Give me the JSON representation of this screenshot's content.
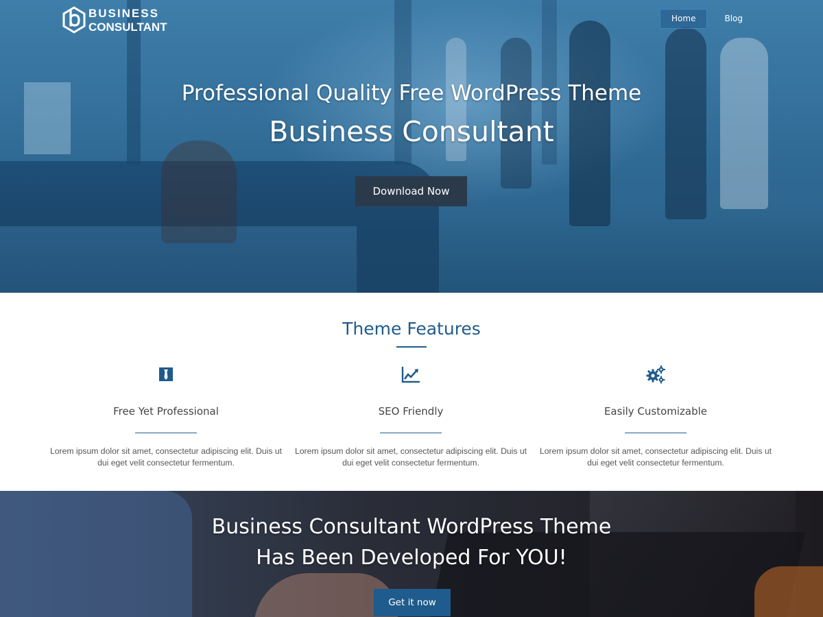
{
  "logo": {
    "line1": "BUSINESS",
    "line2": "CONSULTANT",
    "icon": "hexagon-b-logo-icon"
  },
  "nav": {
    "items": [
      {
        "label": "Home",
        "active": true
      },
      {
        "label": "Blog",
        "active": false
      }
    ]
  },
  "hero": {
    "subtitle": "Professional Quality Free WordPress Theme",
    "title": "Business Consultant",
    "button_label": "Download Now"
  },
  "features": {
    "heading": "Theme Features",
    "items": [
      {
        "icon": "tie-icon",
        "title": "Free Yet Professional",
        "description": "Lorem ipsum dolor sit amet, consectetur adipiscing elit. Duis ut dui eget velit consectetur fermentum."
      },
      {
        "icon": "line-chart-icon",
        "title": "SEO Friendly",
        "description": "Lorem ipsum dolor sit amet, consectetur adipiscing elit. Duis ut dui eget velit consectetur fermentum."
      },
      {
        "icon": "gears-icon",
        "title": "Easily Customizable",
        "description": "Lorem ipsum dolor sit amet, consectetur adipiscing elit. Duis ut dui eget velit consectetur fermentum."
      }
    ]
  },
  "cta": {
    "line1": "Business Consultant WordPress Theme",
    "line2": "Has Been Developed For YOU!",
    "button_label": "Get it now"
  },
  "colors": {
    "accent": "#1f5b8c",
    "dark_button": "#2b3a4b",
    "hero_overlay": "#2f6a94"
  }
}
